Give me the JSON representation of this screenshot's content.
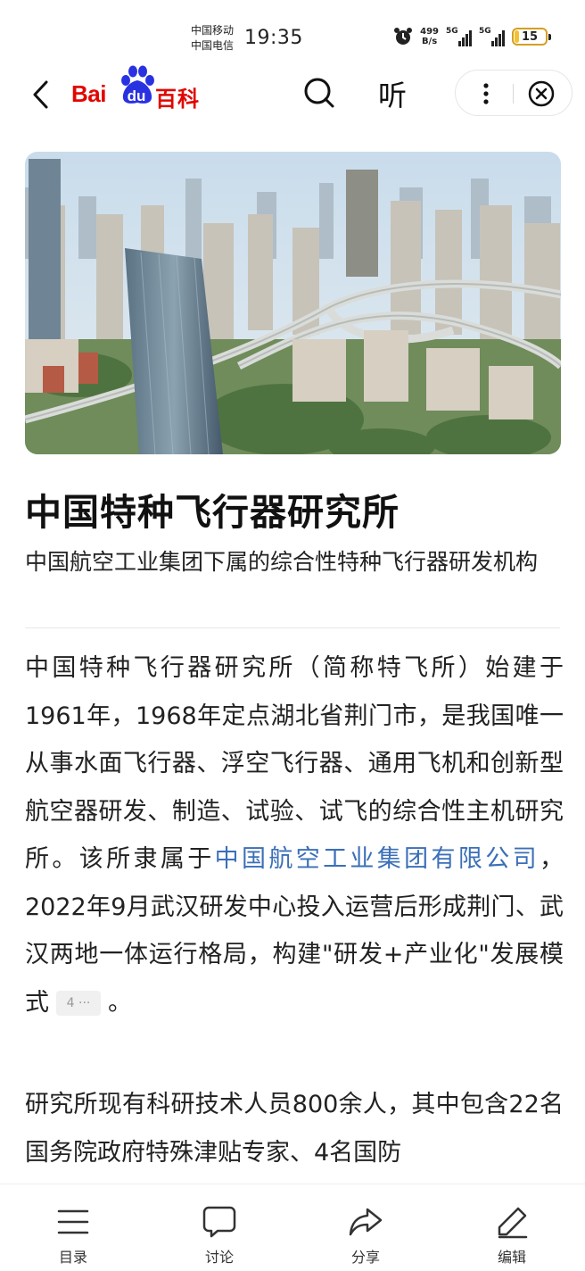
{
  "status": {
    "carrier1": "中国移动",
    "carrier2": "中国电信",
    "time": "19:35",
    "net_speed_value": "499",
    "net_speed_unit": "B/s",
    "signal1_label": "5G",
    "signal2_label": "5G",
    "battery_level": "15"
  },
  "nav": {
    "logo_bai": "Bai",
    "logo_du": "du",
    "logo_baike": "百科",
    "listen_label": "听"
  },
  "article": {
    "title": "中国特种飞行器研究所",
    "subtitle": "中国航空工业集团下属的综合性特种飞行器研发机构",
    "para1_a": "中国特种飞行器研究所（简称特飞所）始建于1961年，1968年定点湖北省荆门市，是我国唯一从事水面飞行器、浮空飞行器、通用飞机和创新型航空器研发、制造、试验、试飞的综合性主机研究所。该所隶属于",
    "para1_link": "中国航空工业集团有限公司",
    "para1_b": "，2022年9月武汉研发中心投入运营后形成荆门、武汉两地一体运行格局，构建\"研发+产业化\"发展模式",
    "para1_ref": "4 ···",
    "para1_end": "。",
    "para2": "研究所现有科研技术人员800余人，其中包含22名国务院政府特殊津贴专家、4名国防"
  },
  "toolbar": {
    "catalog": "目录",
    "discuss": "讨论",
    "share": "分享",
    "edit": "编辑"
  },
  "colors": {
    "brand_red": "#e10601",
    "brand_blue": "#2932e1",
    "link_blue": "#3b6fb8"
  }
}
